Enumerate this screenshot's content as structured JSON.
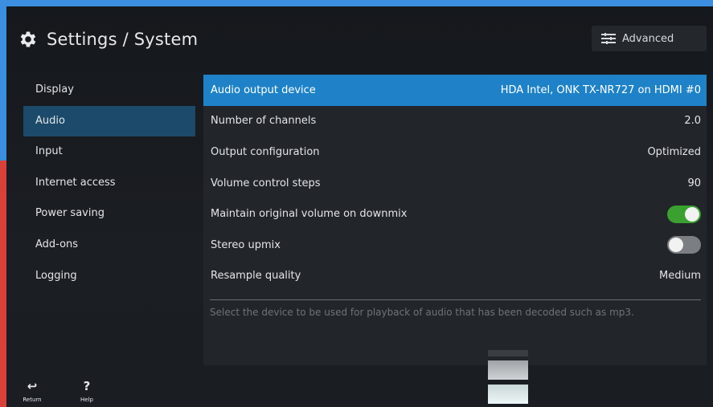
{
  "header": {
    "title": "Settings / System",
    "advanced_label": "Advanced"
  },
  "sidebar": {
    "items": [
      {
        "label": "Display"
      },
      {
        "label": "Audio"
      },
      {
        "label": "Input"
      },
      {
        "label": "Internet access"
      },
      {
        "label": "Power saving"
      },
      {
        "label": "Add-ons"
      },
      {
        "label": "Logging"
      }
    ],
    "active_item": "Audio"
  },
  "settings": {
    "rows": [
      {
        "label": "Audio output device",
        "value": "HDA Intel, ONK TX-NR727 on HDMI #0"
      },
      {
        "label": "Number of channels",
        "value": "2.0"
      },
      {
        "label": "Output configuration",
        "value": "Optimized"
      },
      {
        "label": "Volume control steps",
        "value": "90"
      },
      {
        "label": "Maintain original volume on downmix",
        "toggle": true
      },
      {
        "label": "Stereo upmix",
        "toggle": false
      },
      {
        "label": "Resample quality",
        "value": "Medium"
      }
    ],
    "description": "Select the device to be used for playback of audio that has been decoded such as mp3."
  },
  "footer": {
    "return_label": "Return",
    "help_label": "Help",
    "help_glyph": "?"
  },
  "colors": {
    "accent": "#1f82c8",
    "sidebar_active": "#1c4a6a",
    "toggle_on": "#3aa02f",
    "toggle_off": "#7b7e82"
  }
}
